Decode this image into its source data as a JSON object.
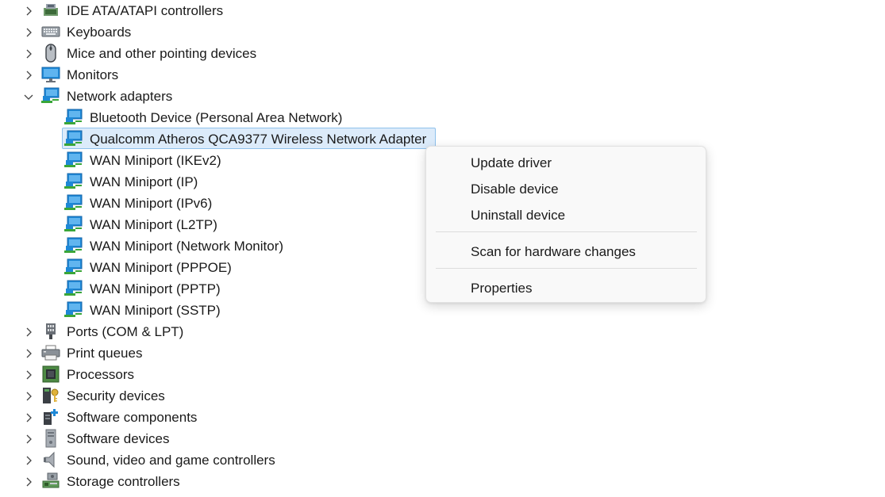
{
  "tree": {
    "before": [
      {
        "label": "IDE ATA/ATAPI controllers",
        "icon": "ide-controller-icon",
        "expanded": false
      },
      {
        "label": "Keyboards",
        "icon": "keyboard-icon",
        "expanded": false
      },
      {
        "label": "Mice and other pointing devices",
        "icon": "mouse-icon",
        "expanded": false
      },
      {
        "label": "Monitors",
        "icon": "monitor-icon",
        "expanded": false
      },
      {
        "label": "Network adapters",
        "icon": "network-adapter-icon",
        "expanded": true
      }
    ],
    "network_adapters": [
      {
        "label": "Bluetooth Device (Personal Area Network)",
        "icon": "network-adapter-icon"
      },
      {
        "label": "Qualcomm Atheros QCA9377 Wireless Network Adapter",
        "icon": "network-adapter-icon",
        "selected": true
      },
      {
        "label": "WAN Miniport (IKEv2)",
        "icon": "network-adapter-icon"
      },
      {
        "label": "WAN Miniport (IP)",
        "icon": "network-adapter-icon"
      },
      {
        "label": "WAN Miniport (IPv6)",
        "icon": "network-adapter-icon"
      },
      {
        "label": "WAN Miniport (L2TP)",
        "icon": "network-adapter-icon"
      },
      {
        "label": "WAN Miniport (Network Monitor)",
        "icon": "network-adapter-icon"
      },
      {
        "label": "WAN Miniport (PPPOE)",
        "icon": "network-adapter-icon"
      },
      {
        "label": "WAN Miniport (PPTP)",
        "icon": "network-adapter-icon"
      },
      {
        "label": "WAN Miniport (SSTP)",
        "icon": "network-adapter-icon"
      }
    ],
    "after": [
      {
        "label": "Ports (COM & LPT)",
        "icon": "port-icon",
        "expanded": false
      },
      {
        "label": "Print queues",
        "icon": "printer-icon",
        "expanded": false
      },
      {
        "label": "Processors",
        "icon": "processor-icon",
        "expanded": false
      },
      {
        "label": "Security devices",
        "icon": "security-device-icon",
        "expanded": false
      },
      {
        "label": "Software components",
        "icon": "software-component-icon",
        "expanded": false
      },
      {
        "label": "Software devices",
        "icon": "software-device-icon",
        "expanded": false
      },
      {
        "label": "Sound, video and game controllers",
        "icon": "speaker-icon",
        "expanded": false
      },
      {
        "label": "Storage controllers",
        "icon": "storage-controller-icon",
        "expanded": false
      }
    ]
  },
  "context_menu": {
    "update_driver": "Update driver",
    "disable_device": "Disable device",
    "uninstall_device": "Uninstall device",
    "scan_hardware": "Scan for hardware changes",
    "properties": "Properties"
  },
  "colors": {
    "selection_bg": "#dcebfa",
    "selection_border": "#8fc1ec",
    "network_icon_blue": "#1e88d6",
    "network_icon_green": "#3aa639"
  }
}
